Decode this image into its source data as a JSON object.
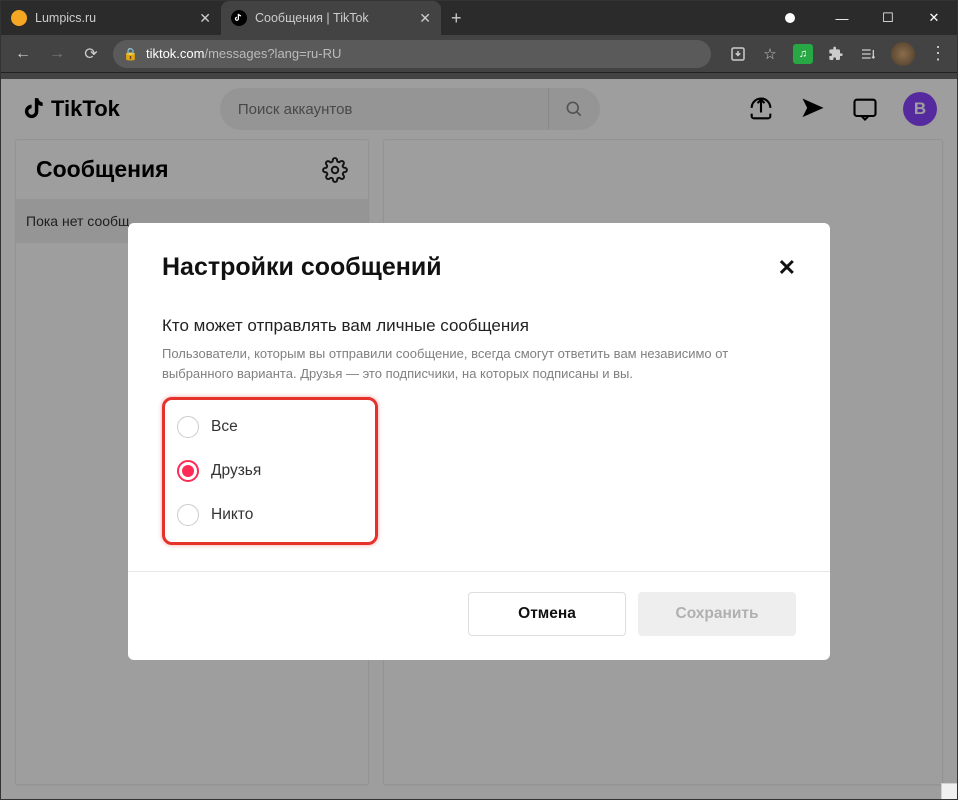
{
  "browser": {
    "tabs": [
      {
        "title": "Lumpics.ru",
        "favicon_color": "#f5a623",
        "active": false
      },
      {
        "title": "Сообщения | TikTok",
        "favicon_bg": "#000",
        "active": true
      }
    ],
    "url_main": "tiktok.com",
    "url_rest": "/messages?lang=ru-RU",
    "avatar_initial": "В"
  },
  "app": {
    "logo_text": "TikTok",
    "search_placeholder": "Поиск аккаунтов",
    "sidebar_title": "Сообщения",
    "sidebar_empty": "Пока нет сообщ"
  },
  "modal": {
    "title": "Настройки сообщений",
    "subtitle": "Кто может отправлять вам личные сообщения",
    "description": "Пользователи, которым вы отправили сообщение, всегда смогут ответить вам независимо от выбранного варианта. Друзья — это подписчики, на которых подписаны и вы.",
    "options": [
      {
        "label": "Все",
        "selected": false
      },
      {
        "label": "Друзья",
        "selected": true
      },
      {
        "label": "Никто",
        "selected": false
      }
    ],
    "cancel": "Отмена",
    "save": "Сохранить"
  }
}
